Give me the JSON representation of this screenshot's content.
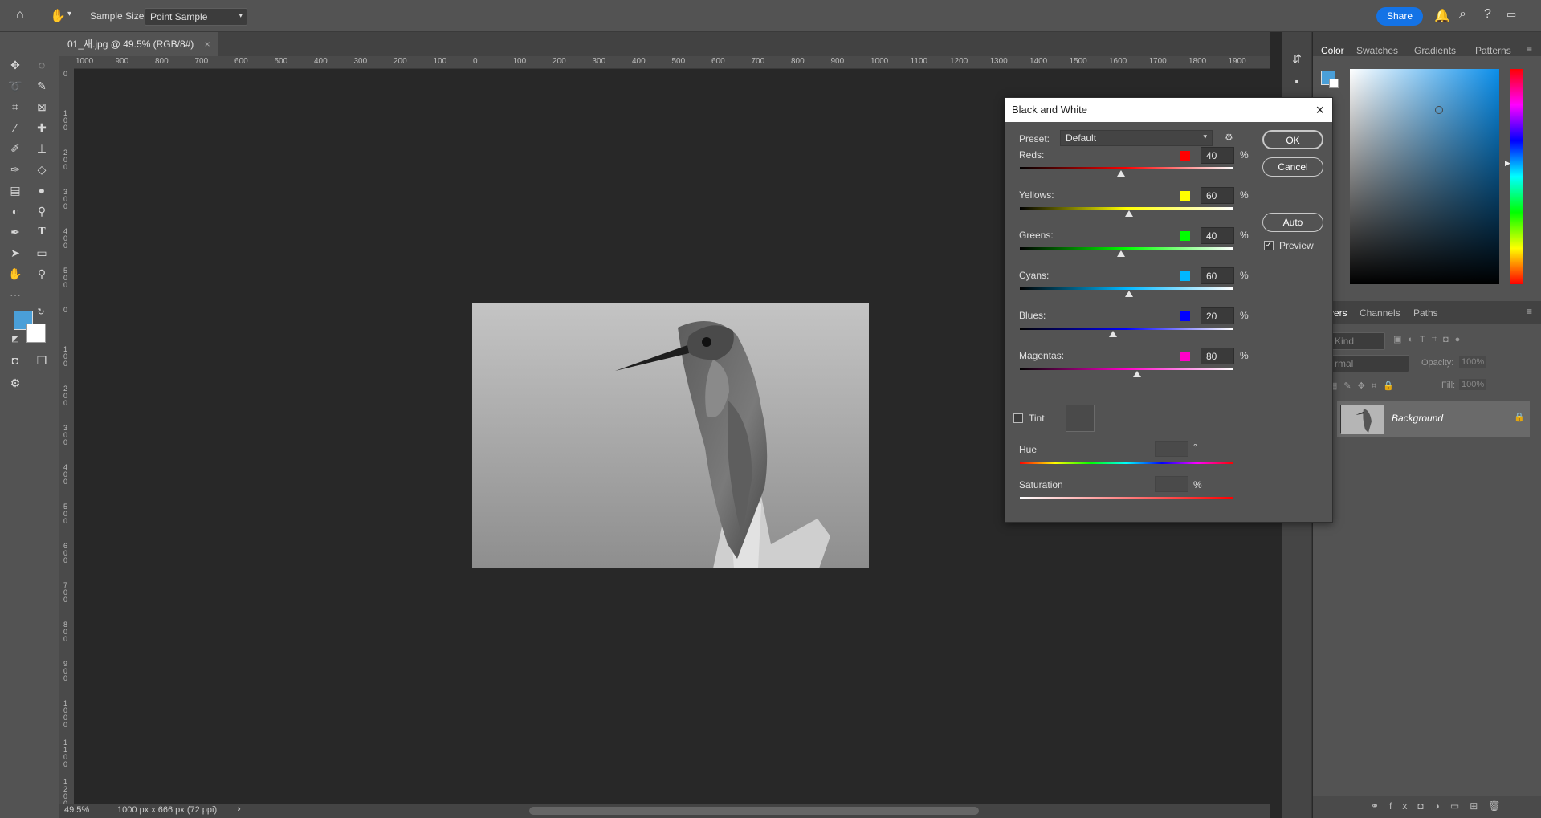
{
  "options_bar": {
    "sample_size_label": "Sample Size:",
    "sample_size_value": "Point Sample",
    "share_label": "Share"
  },
  "document": {
    "tab_title": "01_새.jpg @ 49.5% (RGB/8#)",
    "zoom": "49.5%",
    "info": "1000 px x 666 px (72 ppi)"
  },
  "ruler": {
    "h_ticks": [
      "1000",
      "900",
      "800",
      "700",
      "600",
      "500",
      "400",
      "300",
      "200",
      "100",
      "0",
      "100",
      "200",
      "300",
      "400",
      "500",
      "600",
      "700",
      "800",
      "900",
      "1000",
      "1100",
      "1200",
      "1300",
      "1400",
      "1500",
      "1600",
      "1700",
      "1800",
      "1900"
    ],
    "v_ticks": [
      "0",
      "1 0 0",
      "2 0 0",
      "3 0 0",
      "4 0 0",
      "5 0 0",
      "0",
      "1 0 0",
      "2 0 0",
      "3 0 0",
      "4 0 0",
      "5 0 0",
      "6 0 0",
      "7 0 0",
      "8 0 0",
      "9 0 0",
      "1 0 0 0",
      "1 1 0 0",
      "1 2 0 0"
    ]
  },
  "right_panel": {
    "top_tabs": [
      "Color",
      "Swatches",
      "Gradients",
      "Patterns"
    ],
    "layer_tabs": [
      "yers",
      "Channels",
      "Paths"
    ],
    "kind_label": "Kind",
    "blend_label": "rmal",
    "opacity_label": "Opacity:",
    "opacity_value": "100%",
    "fill_label": "Fill:",
    "fill_value": "100%",
    "layer_name": "Background"
  },
  "dialog": {
    "title": "Black and White",
    "preset_label": "Preset:",
    "preset_value": "Default",
    "ok": "OK",
    "cancel": "Cancel",
    "auto": "Auto",
    "preview_label": "Preview",
    "preview_checked": true,
    "percent": "%",
    "channels": [
      {
        "label": "Reds:",
        "value": "40",
        "color": "#ff0000",
        "level": 0.476
      },
      {
        "label": "Yellows:",
        "value": "60",
        "color": "#ffff00",
        "level": 0.514
      },
      {
        "label": "Greens:",
        "value": "40",
        "color": "#00ff00",
        "level": 0.476
      },
      {
        "label": "Cyans:",
        "value": "60",
        "color": "#00b7ff",
        "level": 0.514
      },
      {
        "label": "Blues:",
        "value": "20",
        "color": "#0000ff",
        "level": 0.438
      },
      {
        "label": "Magentas:",
        "value": "80",
        "color": "#ff00c8",
        "level": 0.552
      }
    ],
    "tint_label": "Tint",
    "hue_label": "Hue",
    "hue_unit": "°",
    "saturation_label": "Saturation",
    "saturation_unit": "%"
  },
  "colors": {
    "foreground": "#4a9fd8",
    "background": "#ffffff",
    "accent": "#1473e6"
  }
}
